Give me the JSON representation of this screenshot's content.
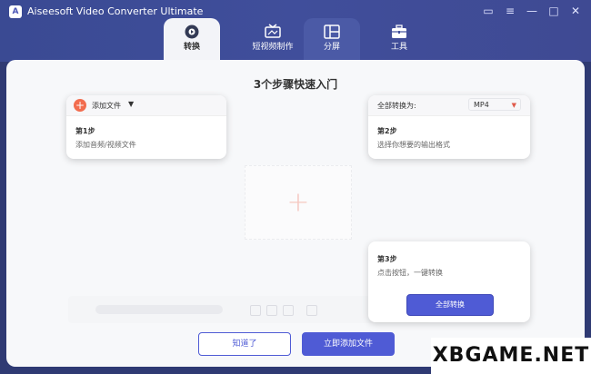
{
  "window": {
    "title": "Aiseesoft Video Converter Ultimate",
    "controls": [
      "feedback-icon",
      "menu-icon",
      "minimize-icon",
      "maximize-icon",
      "close-icon"
    ]
  },
  "nav": {
    "tabs": [
      {
        "label": "转换",
        "icon": "convert-icon",
        "active": true
      },
      {
        "label": "短视频制作",
        "icon": "mv-icon",
        "active": false
      },
      {
        "label": "分屏",
        "icon": "collage-icon",
        "active": false
      },
      {
        "label": "工具",
        "icon": "toolbox-icon",
        "active": false
      }
    ]
  },
  "guide": {
    "title": "3个步骤快速入门",
    "step1": {
      "add_label": "添加文件",
      "label": "第1步",
      "text": "添加音频/视频文件"
    },
    "step2": {
      "convert_all_to": "全部转换为:",
      "format": "MP4",
      "label": "第2步",
      "text": "选择你想要的输出格式"
    },
    "step3": {
      "label": "第3步",
      "text": "点击按钮，一键转换",
      "button": "全部转换"
    }
  },
  "buttons": {
    "ok": "知道了",
    "add_now": "立即添加文件"
  },
  "watermark": "XBGAME.NET",
  "colors": {
    "accent": "#4f5bd5",
    "add_orange": "#f26d4f",
    "header_bg": "#3f4b97"
  }
}
